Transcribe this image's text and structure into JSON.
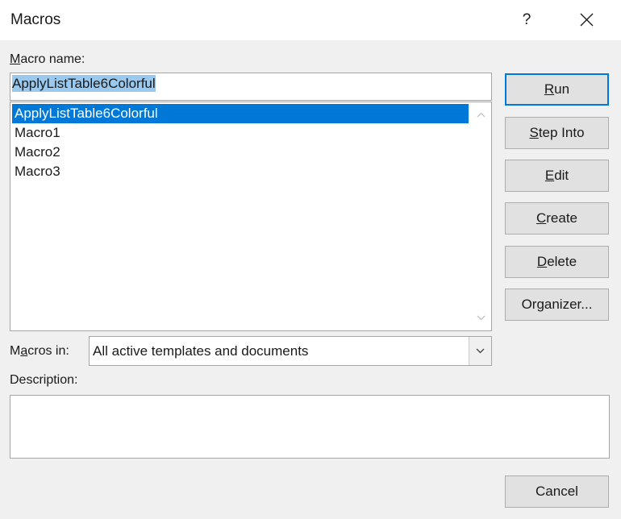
{
  "dialog": {
    "title": "Macros",
    "help_label": "?"
  },
  "macro_name": {
    "label_mnemonic": "M",
    "label_rest": "acro name:",
    "value": "ApplyListTable6Colorful"
  },
  "macro_list": {
    "items": [
      {
        "label": "ApplyListTable6Colorful",
        "selected": true
      },
      {
        "label": "Macro1",
        "selected": false
      },
      {
        "label": "Macro2",
        "selected": false
      },
      {
        "label": "Macro3",
        "selected": false
      }
    ]
  },
  "macros_in": {
    "label_pre": "M",
    "label_mnemonic": "a",
    "label_rest": "cros in:",
    "selected": "All active templates and documents"
  },
  "description": {
    "label": "Description:",
    "value": ""
  },
  "buttons": {
    "run": {
      "mnemonic": "R",
      "rest": "un"
    },
    "step_into": {
      "mnemonic": "S",
      "rest": "tep Into"
    },
    "edit": {
      "mnemonic": "E",
      "rest": "dit"
    },
    "create": {
      "mnemonic": "C",
      "rest": "reate"
    },
    "delete": {
      "mnemonic": "D",
      "rest": "elete"
    },
    "organizer": {
      "label": "Organizer..."
    },
    "cancel": {
      "label": "Cancel"
    }
  },
  "colors": {
    "selection": "#0078d7",
    "input_selection": "#99c9ef",
    "default_button_border": "#0078d7"
  }
}
